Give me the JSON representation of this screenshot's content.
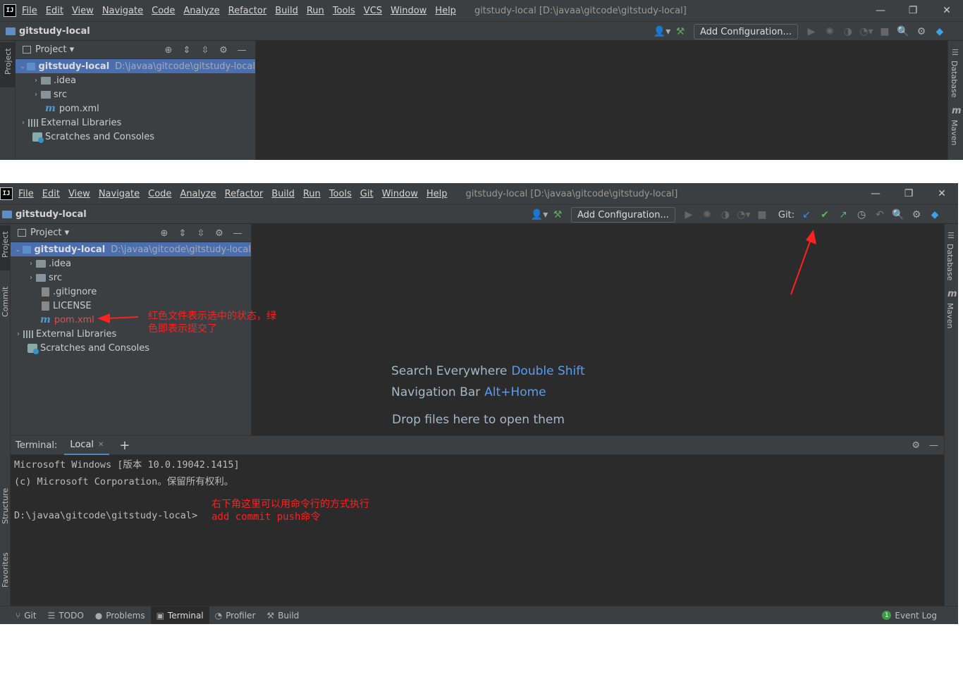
{
  "app": {
    "logo": "IJ"
  },
  "window1": {
    "menu": [
      "File",
      "Edit",
      "View",
      "Navigate",
      "Code",
      "Analyze",
      "Refactor",
      "Build",
      "Run",
      "Tools",
      "VCS",
      "Window",
      "Help"
    ],
    "title": "gitstudy-local [D:\\javaa\\gitcode\\gitstudy-local]",
    "breadcrumb": "gitstudy-local",
    "add_config": "Add Configuration...",
    "left_tab": "Project",
    "right_tabs": [
      "Database",
      "Maven"
    ],
    "project_header": "Project",
    "tree": {
      "root": "gitstudy-local",
      "root_path": "D:\\javaa\\gitcode\\gitstudy-local",
      "idea": ".idea",
      "src": "src",
      "pom": "pom.xml",
      "ext": "External Libraries",
      "scratch": "Scratches and Consoles"
    }
  },
  "window2": {
    "menu": [
      "File",
      "Edit",
      "View",
      "Navigate",
      "Code",
      "Analyze",
      "Refactor",
      "Build",
      "Run",
      "Tools",
      "Git",
      "Window",
      "Help"
    ],
    "title": "gitstudy-local [D:\\javaa\\gitcode\\gitstudy-local]",
    "breadcrumb": "gitstudy-local",
    "add_config": "Add Configuration...",
    "git_label": "Git:",
    "left_tabs": [
      "Project",
      "Commit",
      "Structure",
      "Favorites"
    ],
    "right_tabs": [
      "Database",
      "Maven"
    ],
    "project_header": "Project",
    "tree": {
      "root": "gitstudy-local",
      "root_path": "D:\\javaa\\gitcode\\gitstudy-local",
      "idea": ".idea",
      "src": "src",
      "gitignore": ".gitignore",
      "license": "LICENSE",
      "pom": "pom.xml",
      "ext": "External Libraries",
      "scratch": "Scratches and Consoles"
    },
    "editor_hints": {
      "search_label": "Search Everywhere",
      "search_key": "Double Shift",
      "nav_label": "Navigation Bar",
      "nav_key": "Alt+Home",
      "drop": "Drop files here to open them"
    },
    "terminal": {
      "label": "Terminal:",
      "tab": "Local",
      "lines": [
        "Microsoft Windows [版本 10.0.19042.1415]",
        "(c) Microsoft Corporation。保留所有权利。",
        "",
        "D:\\javaa\\gitcode\\gitstudy-local>"
      ]
    },
    "statusbar": [
      "Git",
      "TODO",
      "Problems",
      "Terminal",
      "Profiler",
      "Build"
    ],
    "event_log": "Event Log",
    "event_count": "1"
  },
  "annotations": {
    "pom_note_l1": "红色文件表示选中的状态，绿",
    "pom_note_l2": "色即表示提交了",
    "term_note_l1": "右下角这里可以用命令行的方式执行",
    "term_note_l2": "add commit push命令"
  },
  "colors": {
    "selected_row": "#4b6eaf",
    "annotation": "#ff2020",
    "pom_modified": "#d9534f",
    "link_key": "#589df6"
  }
}
